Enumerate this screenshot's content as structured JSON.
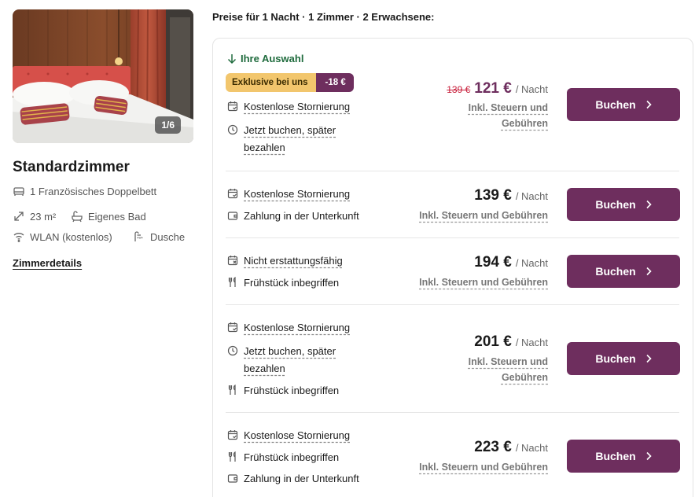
{
  "room": {
    "photo_counter": "1/6",
    "title": "Standardzimmer",
    "bed": "1 Französisches Doppelbett",
    "size": "23 m²",
    "bath": "Eigenes Bad",
    "wifi": "WLAN (kostenlos)",
    "shower": "Dusche",
    "details_link": "Zimmerdetails"
  },
  "header": "Preise für 1 Nacht · 1 Zimmer · 2 Erwachsene:",
  "selection_label": "Ihre Auswahl",
  "badge": {
    "label": "Exklusive bei uns",
    "discount": "-18 €"
  },
  "colors": {
    "brand": "#6e2e5e",
    "badge_yellow": "#f2c66d",
    "selection_green": "#1f6b3d",
    "strike_red": "#c81e3a"
  },
  "rates": [
    {
      "old_price": "139 €",
      "price": "121 €",
      "unit": "/ Nacht",
      "tax_line1": "Inkl. Steuern und",
      "tax_line2": "Gebühren",
      "button": "Buchen",
      "features": [
        {
          "icon": "calendar-cancel-icon",
          "text": "Kostenlose Stornierung"
        },
        {
          "icon": "clock-icon",
          "text_line1": "Jetzt buchen, später",
          "text_line2": "bezahlen"
        }
      ]
    },
    {
      "price": "139 €",
      "unit": "/ Nacht",
      "tax": "Inkl. Steuern und Gebühren",
      "button": "Buchen",
      "features": [
        {
          "icon": "calendar-cancel-icon",
          "text": "Kostenlose Stornierung"
        },
        {
          "icon": "wallet-icon",
          "text": "Zahlung in der Unterkunft"
        }
      ]
    },
    {
      "price": "194 €",
      "unit": "/ Nacht",
      "tax": "Inkl. Steuern und Gebühren",
      "button": "Buchen",
      "features": [
        {
          "icon": "calendar-x-icon",
          "text": "Nicht erstattungsfähig"
        },
        {
          "icon": "cutlery-icon",
          "text": "Frühstück inbegriffen"
        }
      ]
    },
    {
      "price": "201 €",
      "unit": "/ Nacht",
      "tax_line1": "Inkl. Steuern und",
      "tax_line2": "Gebühren",
      "button": "Buchen",
      "features": [
        {
          "icon": "calendar-cancel-icon",
          "text": "Kostenlose Stornierung"
        },
        {
          "icon": "clock-icon",
          "text_line1": "Jetzt buchen, später",
          "text_line2": "bezahlen"
        },
        {
          "icon": "cutlery-icon",
          "text": "Frühstück inbegriffen"
        }
      ]
    },
    {
      "price": "223 €",
      "unit": "/ Nacht",
      "tax": "Inkl. Steuern und Gebühren",
      "button": "Buchen",
      "features": [
        {
          "icon": "calendar-cancel-icon",
          "text": "Kostenlose Stornierung"
        },
        {
          "icon": "cutlery-icon",
          "text": "Frühstück inbegriffen"
        },
        {
          "icon": "wallet-icon",
          "text": "Zahlung in der Unterkunft"
        }
      ]
    }
  ]
}
